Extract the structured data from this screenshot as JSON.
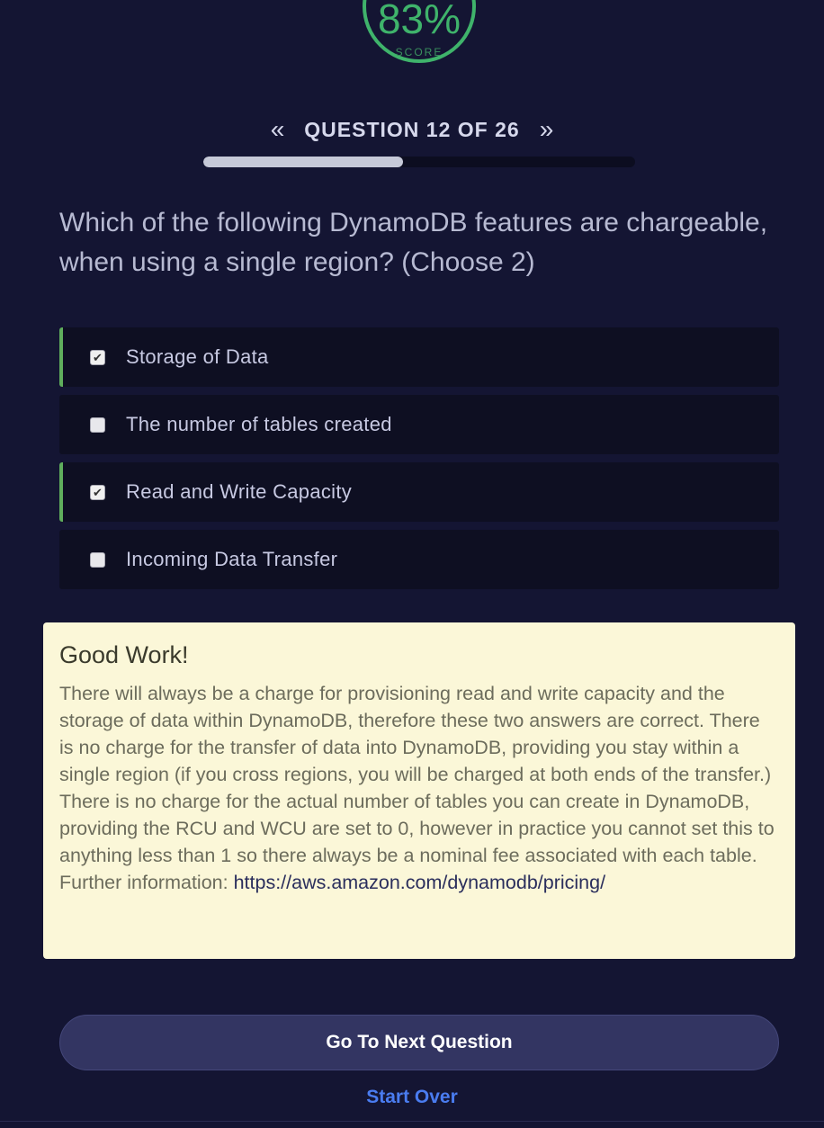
{
  "score": {
    "value": "83%",
    "label": "SCORE",
    "color": "#3fb36b"
  },
  "navigation": {
    "prev_icon": "double-chevron-left",
    "next_icon": "double-chevron-right",
    "counter": "QUESTION 12 OF 26",
    "progress_fraction": 0.4615
  },
  "question": {
    "text": "Which of the following DynamoDB features are chargeable, when using a single region? (Choose 2)"
  },
  "answers": [
    {
      "label": "Storage of Data",
      "selected": true
    },
    {
      "label": "The number of tables created",
      "selected": false
    },
    {
      "label": "Read and Write Capacity",
      "selected": true
    },
    {
      "label": "Incoming Data Transfer",
      "selected": false
    }
  ],
  "feedback": {
    "title": "Good Work!",
    "text": "There will always be a charge for provisioning read and write capacity and the storage of data within DynamoDB, therefore these two answers are correct. There is no charge for the transfer of data into DynamoDB, providing you stay within a single region (if you cross regions, you will be charged at both ends of the transfer.) There is no charge for the actual number of tables you can create in DynamoDB, providing the RCU and WCU are set to 0, however in practice you cannot set this to anything less than 1 so there always be a nominal fee associated with each table. Further information: ",
    "link_text": "https://aws.amazon.com/dynamodb/pricing/",
    "background_color": "#fbf7d8"
  },
  "actions": {
    "next_label": "Go To Next Question",
    "start_over_label": "Start Over",
    "link_color": "#4a7cf0"
  }
}
